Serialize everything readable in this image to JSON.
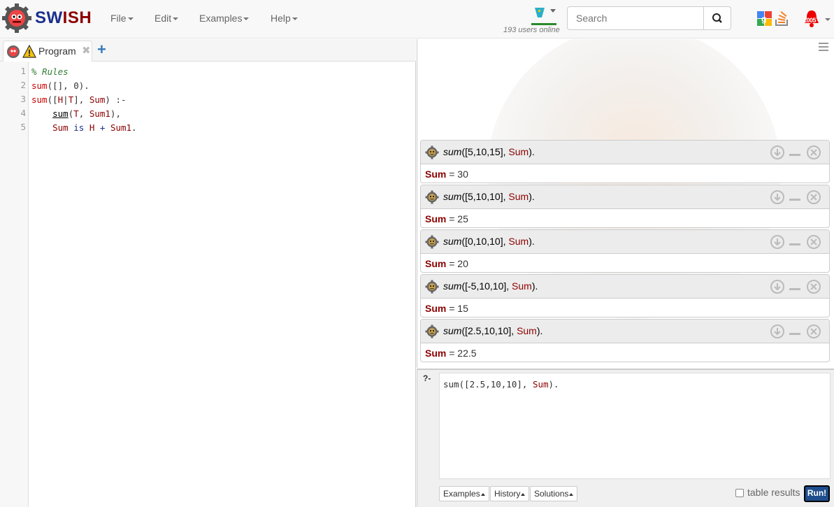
{
  "navbar": {
    "brand_sw": "SW",
    "brand_ish": "ISH",
    "menus": [
      "File",
      "Edit",
      "Examples",
      "Help"
    ],
    "users_online": "193 users online",
    "search_placeholder": "Search",
    "notification_count": "1005"
  },
  "editor": {
    "tab_label": "Program",
    "line_numbers": [
      "1",
      "2",
      "3",
      "4",
      "5"
    ]
  },
  "results": [
    {
      "query_pred": "sum",
      "query_args": "([5,10,15], ",
      "query_var": "Sum",
      "query_end": ").",
      "ans_var": "Sum",
      "ans_val": " = 30"
    },
    {
      "query_pred": "sum",
      "query_args": "([5,10,10], ",
      "query_var": "Sum",
      "query_end": ").",
      "ans_var": "Sum",
      "ans_val": " = 25"
    },
    {
      "query_pred": "sum",
      "query_args": "([0,10,10], ",
      "query_var": "Sum",
      "query_end": ").",
      "ans_var": "Sum",
      "ans_val": " = 20"
    },
    {
      "query_pred": "sum",
      "query_args": "([-5,10,10], ",
      "query_var": "Sum",
      "query_end": ").",
      "ans_var": "Sum",
      "ans_val": " = 15"
    },
    {
      "query_pred": "sum",
      "query_args": "([2.5,10,10], ",
      "query_var": "Sum",
      "query_end": ").",
      "ans_var": "Sum",
      "ans_val": " = 22.5"
    }
  ],
  "query": {
    "prompt": "?-",
    "text_pre": "sum([2.5,10,10], ",
    "text_var": "Sum",
    "text_post": ").",
    "examples_label": "Examples",
    "history_label": "History",
    "solutions_label": "Solutions",
    "table_results_label": "table results",
    "table_results_checked": false,
    "run_label": "Run!"
  },
  "colors": {
    "brand_blue": "#1b2f8c",
    "brand_red": "#8b0000",
    "run_button": "#1f4e8c"
  }
}
